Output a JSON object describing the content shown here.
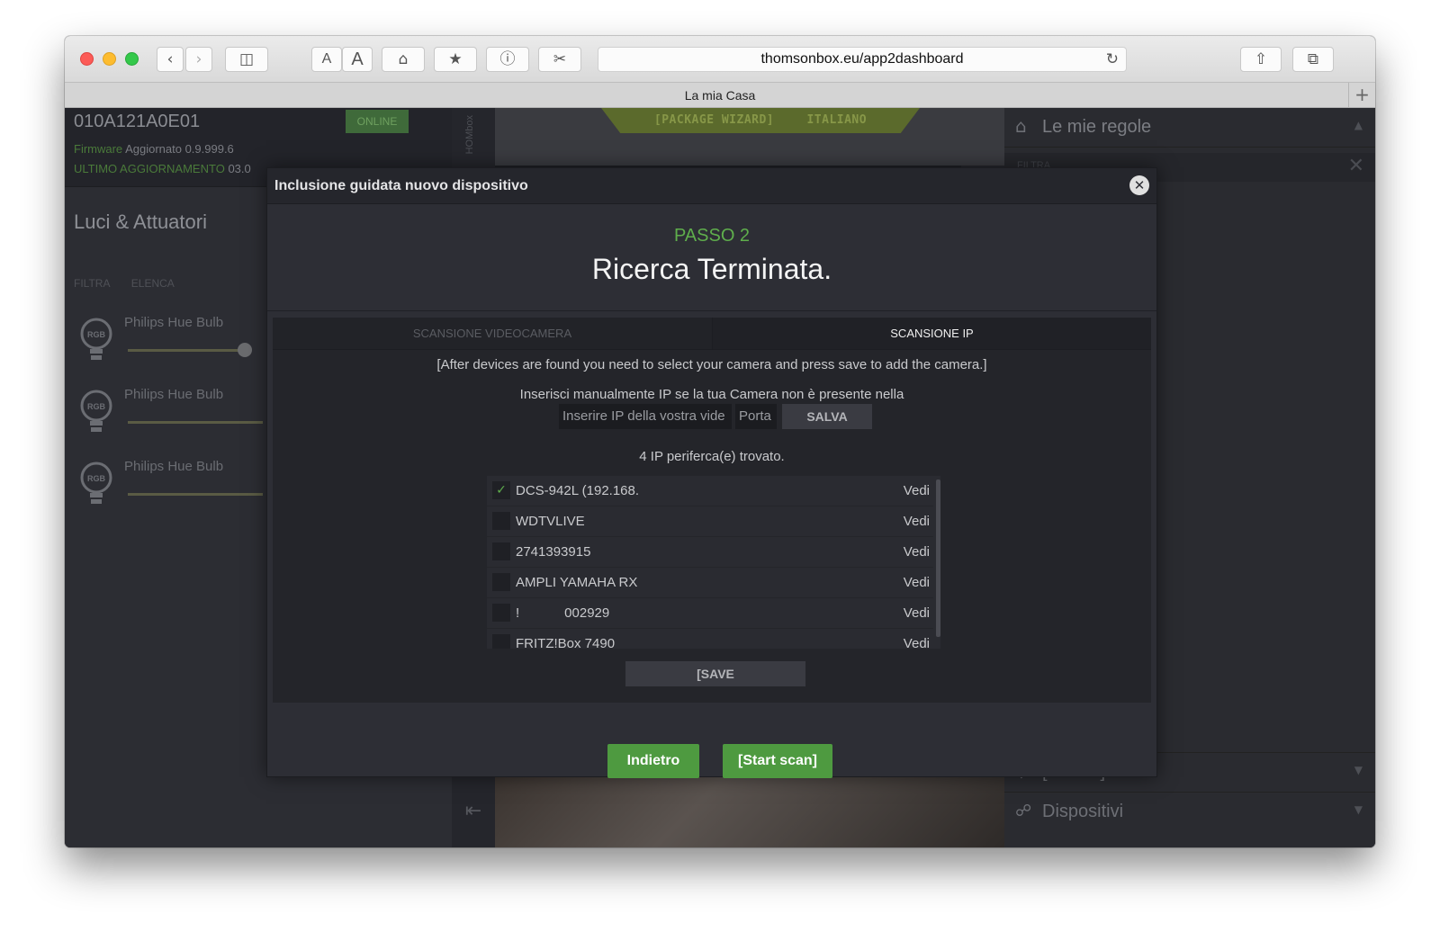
{
  "browser": {
    "url": "thomsonbox.eu/app2dashboard",
    "tab_title": "La mia Casa",
    "font_small": "A",
    "font_large": "A"
  },
  "left_panel": {
    "device_id": "010A121A0E01",
    "status": "ONLINE",
    "firmware_label": "Firmware",
    "firmware_value": "Aggiornato 0.9.999.6",
    "last_update_label": "ULTIMO AGGIORNAMENTO",
    "last_update_value": "03.0",
    "section_title": "Luci & Attuatori",
    "filter_label": "FILTRA",
    "list_label": "ELENCA",
    "bulb_badge": "RGB",
    "devices": [
      {
        "name": "Philips Hue Bulb",
        "level": 0.95
      },
      {
        "name": "Philips Hue Bulb",
        "level": 1.0
      },
      {
        "name": "Philips Hue Bulb",
        "level": 1.0
      }
    ]
  },
  "center": {
    "side_label": "HOMbox",
    "ribbon_wizard": "[PACKAGE WIZARD]",
    "ribbon_lang": "ITALIANO"
  },
  "right_panel": {
    "rules_title": "Le mie regole",
    "filter_placeholder": "FILTRA",
    "blocks": "[Blocks]",
    "devices": "Dispositivi"
  },
  "modal": {
    "title": "Inclusione guidata nuovo dispositivo",
    "step": "PASSO 2",
    "heading": "Ricerca Terminata.",
    "tabs": [
      {
        "label": "SCANSIONE VIDEOCAMERA",
        "active": false
      },
      {
        "label": "SCANSIONE IP",
        "active": true
      }
    ],
    "note": "[After devices are found you need to select your camera and press save to add the camera.]",
    "manual_hint": "Inserisci manualmente IP se la tua Camera non è presente nella",
    "ip_placeholder": "Inserire IP della vostra vide",
    "port_placeholder": "Porta",
    "salva": "SALVA",
    "found_text": "4 IP periferca(e) trovato.",
    "view_label": "Vedi",
    "devices": [
      {
        "name": "DCS-942L (192.168.",
        "checked": true
      },
      {
        "name": "WDTVLIVE",
        "checked": false
      },
      {
        "name": "2741393915",
        "checked": false
      },
      {
        "name": "AMPLI YAMAHA RX",
        "checked": false
      },
      {
        "name": "!            002929",
        "checked": false
      },
      {
        "name": "FRITZ!Box 7490",
        "checked": false
      }
    ],
    "save": "[SAVE",
    "back": "Indietro",
    "start_scan": "[Start scan]"
  },
  "colors": {
    "accent_green": "#4e9a40",
    "step_green": "#5fae4c",
    "modal_bg": "#2d2e35"
  }
}
